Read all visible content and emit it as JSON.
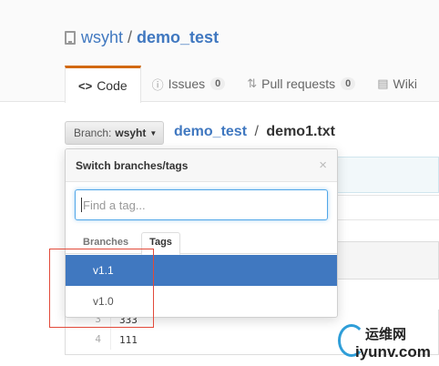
{
  "repo": {
    "owner": "wsyht",
    "separator": "/",
    "name": "demo_test"
  },
  "tabs": [
    {
      "icon": "<>",
      "label": "Code"
    },
    {
      "icon": "ⓘ",
      "label": "Issues",
      "count": "0"
    },
    {
      "icon": "⇅",
      "label": "Pull requests",
      "count": "0"
    },
    {
      "icon": "▤",
      "label": "Wiki"
    }
  ],
  "branch_button": {
    "prefix": "Branch:",
    "branch": "wsyht"
  },
  "breadcrumb": {
    "root": "demo_test",
    "separator": "/",
    "file": "demo1.txt"
  },
  "dropdown": {
    "title": "Switch branches/tags",
    "close": "×",
    "filter_placeholder": "Find a tag...",
    "tab_branches": "Branches",
    "tab_tags": "Tags",
    "items": [
      "v1.1",
      "v1.0"
    ]
  },
  "code_lines": [
    {
      "num": "3",
      "text": "333"
    },
    {
      "num": "4",
      "text": "111"
    }
  ],
  "watermark": {
    "top": "运维网",
    "bottom": "iyunv.com"
  },
  "colors": {
    "accent": "#4078c0",
    "tab_border": "#d26911",
    "annotation": "#e24a3a"
  }
}
